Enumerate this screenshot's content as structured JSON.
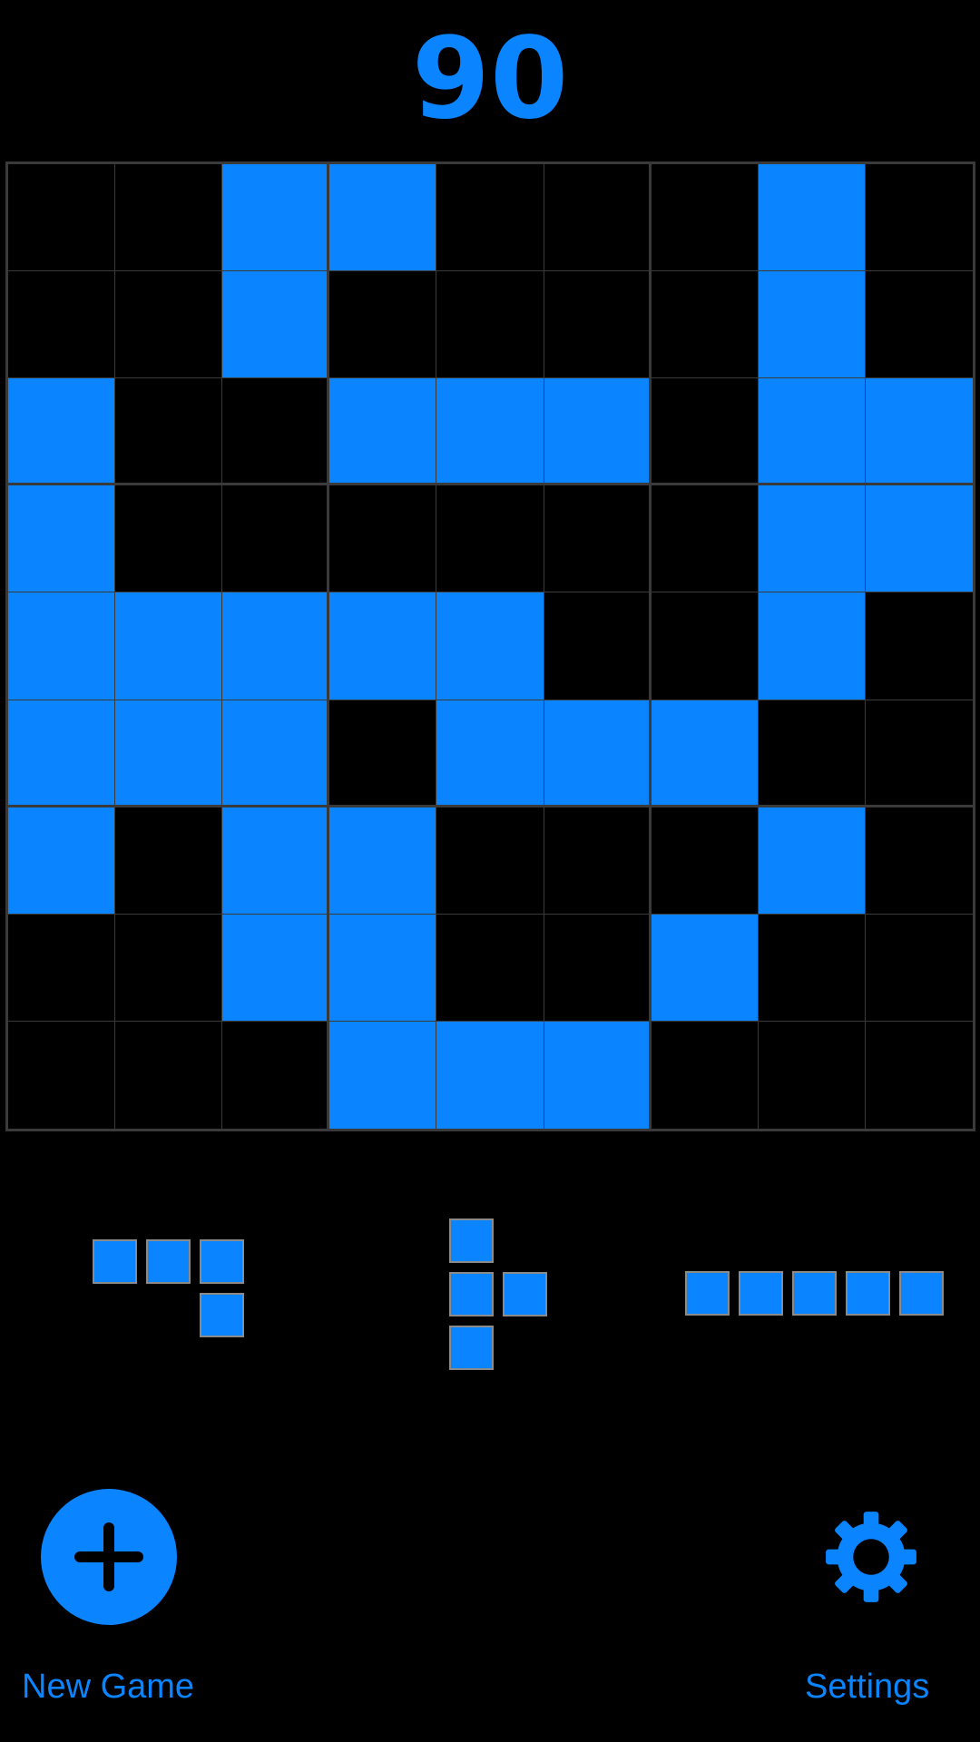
{
  "score": "90",
  "accent_color": "#0a84ff",
  "board": {
    "size": 9,
    "rows": [
      [
        0,
        0,
        1,
        1,
        0,
        0,
        0,
        1,
        0
      ],
      [
        0,
        0,
        1,
        0,
        0,
        0,
        0,
        1,
        0
      ],
      [
        1,
        0,
        0,
        1,
        1,
        1,
        0,
        1,
        1
      ],
      [
        1,
        0,
        0,
        0,
        0,
        0,
        0,
        1,
        1
      ],
      [
        1,
        1,
        1,
        1,
        1,
        0,
        0,
        1,
        0
      ],
      [
        1,
        1,
        1,
        0,
        1,
        1,
        1,
        0,
        0
      ],
      [
        1,
        0,
        1,
        1,
        0,
        0,
        0,
        1,
        0
      ],
      [
        0,
        0,
        1,
        1,
        0,
        0,
        1,
        0,
        0
      ],
      [
        0,
        0,
        0,
        1,
        1,
        1,
        0,
        0,
        0
      ]
    ]
  },
  "pieces": [
    {
      "cells": [
        [
          0,
          0
        ],
        [
          0,
          1
        ],
        [
          0,
          2
        ],
        [
          1,
          2
        ]
      ]
    },
    {
      "cells": [
        [
          0,
          0
        ],
        [
          1,
          0
        ],
        [
          1,
          1
        ],
        [
          2,
          0
        ]
      ]
    },
    {
      "cells": [
        [
          0,
          0
        ],
        [
          0,
          1
        ],
        [
          0,
          2
        ],
        [
          0,
          3
        ],
        [
          0,
          4
        ]
      ]
    }
  ],
  "controls": {
    "new_game_label": "New Game",
    "new_game_icon": "plus-icon",
    "settings_label": "Settings",
    "settings_icon": "gear-icon"
  }
}
